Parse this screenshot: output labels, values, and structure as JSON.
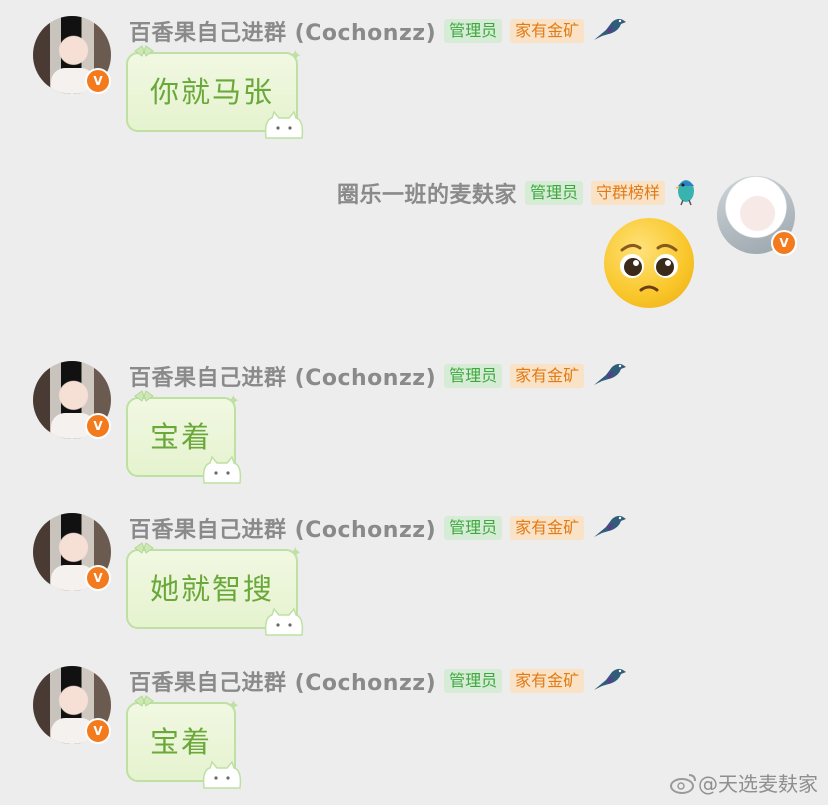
{
  "messages": [
    {
      "side": "left",
      "name": "百香果自己进群 (Cochonzz)",
      "badges": [
        "管理员",
        "家有金矿"
      ],
      "text": "你就马张"
    },
    {
      "side": "right",
      "name": "圈乐一班的麦麸家",
      "badges": [
        "管理员",
        "守群榜样"
      ],
      "emoji": "pleading-face-emoji"
    },
    {
      "side": "left",
      "name": "百香果自己进群 (Cochonzz)",
      "badges": [
        "管理员",
        "家有金矿"
      ],
      "text": "宝着"
    },
    {
      "side": "left",
      "name": "百香果自己进群 (Cochonzz)",
      "badges": [
        "管理员",
        "家有金矿"
      ],
      "text": "她就智搜"
    },
    {
      "side": "left",
      "name": "百香果自己进群 (Cochonzz)",
      "badges": [
        "管理员",
        "家有金矿"
      ],
      "text": "宝着"
    }
  ],
  "avatar_badge": "V",
  "watermark": "@天选麦麸家",
  "colors": {
    "background": "#ededed",
    "bubble": "#e8f5d3",
    "bubble_text": "#6aa83a",
    "admin_badge": "#3ea83e",
    "gold_badge": "#e27b15",
    "avatar_badge": "#f37b1d"
  }
}
